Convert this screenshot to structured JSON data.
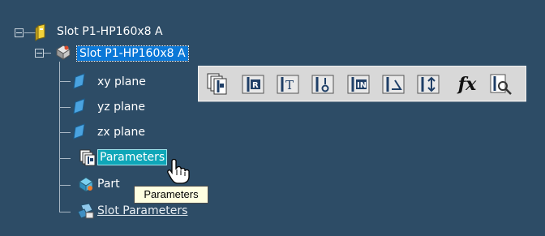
{
  "tree": {
    "root": {
      "label": "Slot P1-HP160x8 A",
      "icon": "part-document-icon"
    },
    "part": {
      "label": "Slot P1-HP160x8 A",
      "icon": "part-body-icon",
      "selected": true
    },
    "items": [
      {
        "label": "xy plane",
        "icon": "plane-icon"
      },
      {
        "label": "yz plane",
        "icon": "plane-icon"
      },
      {
        "label": "zx plane",
        "icon": "plane-icon"
      },
      {
        "label": "Parameters",
        "icon": "parameters-icon"
      },
      {
        "label": "Part",
        "icon": "part-body-icon"
      },
      {
        "label": "Slot Parameters",
        "icon": "slot-parameters-icon"
      }
    ]
  },
  "toolbar": {
    "buttons": [
      {
        "name": "parameters-knowledge-icon"
      },
      {
        "name": "reaction-icon"
      },
      {
        "name": "text-parameter-icon"
      },
      {
        "name": "boolean-parameter-icon"
      },
      {
        "name": "integer-parameter-icon"
      },
      {
        "name": "angle-parameter-icon"
      },
      {
        "name": "length-parameter-icon"
      },
      {
        "name": "formula-icon",
        "glyph": "fx"
      },
      {
        "name": "search-parameter-icon"
      }
    ]
  },
  "tooltip": {
    "text": "Parameters"
  },
  "colors": {
    "background": "#2d4c66",
    "selection": "#0b78d7",
    "hover": "#0fa6b8",
    "tooltip": "#ffffe1",
    "toolbar": "#d8d8d8"
  }
}
